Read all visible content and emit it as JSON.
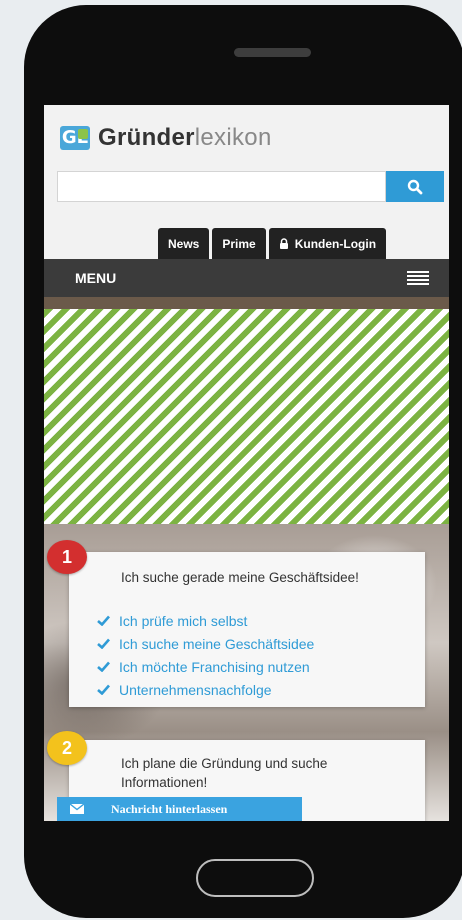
{
  "logo": {
    "badge": "GL",
    "name_bold": "Gründer",
    "name_light": "lexikon"
  },
  "search": {
    "value": "",
    "placeholder": "",
    "icon": "search-icon"
  },
  "top_nav": [
    {
      "label": "News"
    },
    {
      "label": "Prime"
    },
    {
      "label": "Kunden-Login",
      "icon": "lock-icon"
    }
  ],
  "menu": {
    "label": "MENU",
    "icon": "hamburger-icon"
  },
  "cards": [
    {
      "number": "1",
      "heading": "Ich suche gerade meine Geschäftsidee!",
      "links": [
        "Ich prüfe mich selbst",
        "Ich suche meine Geschäftsidee",
        "Ich möchte Franchising nutzen",
        "Unternehmensnachfolge"
      ]
    },
    {
      "number": "2",
      "heading": "Ich plane die Gründung und suche Informationen!"
    }
  ],
  "message_button": {
    "label": "Nachricht hinterlassen",
    "icon": "envelope-icon"
  },
  "colors": {
    "accent": "#2f9bd6",
    "stripe": "#7cb342",
    "badge1": "#d32f2f",
    "badge2": "#f3c21c"
  }
}
